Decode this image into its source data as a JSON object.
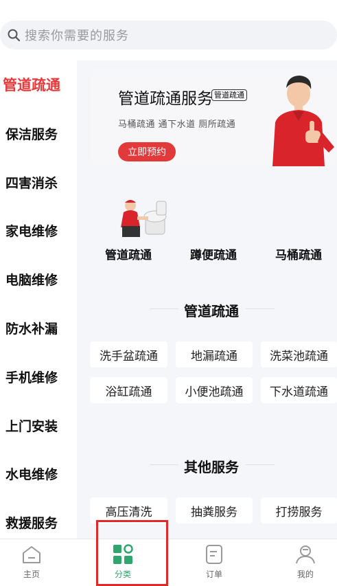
{
  "search": {
    "placeholder": "搜索你需要的服务"
  },
  "sidebar": {
    "items": [
      {
        "label": "管道疏通",
        "active": true
      },
      {
        "label": "保洁服务"
      },
      {
        "label": "四害消杀"
      },
      {
        "label": "家电维修"
      },
      {
        "label": "电脑维修"
      },
      {
        "label": "防水补漏"
      },
      {
        "label": "手机维修"
      },
      {
        "label": "上门安装"
      },
      {
        "label": "水电维修"
      },
      {
        "label": "救援服务"
      }
    ]
  },
  "banner": {
    "title": "管道疏通服务",
    "tag": "管道疏通",
    "subtitle": "马桶疏通 通下水道 厕所疏通",
    "button": "立即预约"
  },
  "sub_categories": [
    {
      "label": "管道疏通"
    },
    {
      "label": "蹲便疏通"
    },
    {
      "label": "马桶疏通"
    }
  ],
  "sections": [
    {
      "title": "管道疏通",
      "items": [
        "洗手盆疏通",
        "地漏疏通",
        "洗菜池疏通",
        "浴缸疏通",
        "小便池疏通",
        "下水道疏通"
      ]
    },
    {
      "title": "其他服务",
      "items": [
        "高压清洗",
        "抽粪服务",
        "打捞服务"
      ]
    }
  ],
  "tabbar": [
    {
      "label": "主页",
      "icon": "home-icon"
    },
    {
      "label": "分类",
      "icon": "category-icon",
      "active": true
    },
    {
      "label": "订单",
      "icon": "order-icon"
    },
    {
      "label": "我的",
      "icon": "profile-icon"
    }
  ],
  "colors": {
    "accent_red": "#e8393a",
    "active_green": "#2fa66e"
  }
}
